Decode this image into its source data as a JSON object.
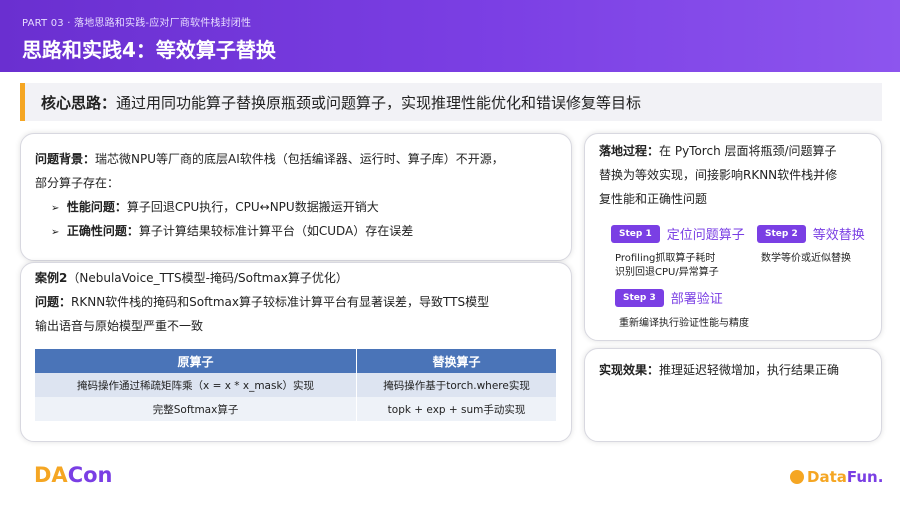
{
  "header": {
    "part_label": "PART 03 · 落地思路和实践-应对厂商软件栈封闭性",
    "title": "思路和实践4：等效算子替换"
  },
  "core": {
    "label": "核心思路：",
    "text": "通过用同功能算子替换原瓶颈或问题算子，实现推理性能优化和错误修复等目标"
  },
  "background": {
    "label": "问题背景：",
    "text1": "瑞芯微NPU等厂商的底层AI软件栈（包括编译器、运行时、算子库）不开源，",
    "text2": "部分算子存在：",
    "bullets": [
      {
        "label": "性能问题：",
        "text": "算子回退CPU执行，CPU↔NPU数据搬运开销大"
      },
      {
        "label": "正确性问题：",
        "text": "算子计算结果较标准计算平台（如CUDA）存在误差"
      }
    ]
  },
  "case": {
    "label": "案例2",
    "title_rest": "（NebulaVoice_TTS模型-掩码/Softmax算子优化）",
    "problem_label": "问题：",
    "problem_text1": "RKNN软件栈的掩码和Softmax算子较标准计算平台有显著误差，导致TTS模型",
    "problem_text2": "输出语音与原始模型严重不一致",
    "table": {
      "headers": [
        "原算子",
        "替换算子"
      ],
      "rows": [
        [
          "掩码操作通过稀疏矩阵乘（x = x * x_mask）实现",
          "掩码操作基于torch.where实现"
        ],
        [
          "完整Softmax算子",
          "topk + exp + sum手动实现"
        ]
      ]
    }
  },
  "process": {
    "label": "落地过程：",
    "text1": "在 PyTorch 层面将瓶颈/问题算子",
    "text2": "替换为等效实现，间接影响RKNN软件栈并修",
    "text3": "复性能和正确性问题",
    "steps": [
      {
        "badge": "Step 1",
        "title": "定位问题算子",
        "desc1": "Profiling抓取算子耗时",
        "desc2": "识别回退CPU/异常算子"
      },
      {
        "badge": "Step 2",
        "title": "等效替换",
        "desc1": "数学等价或近似替换"
      },
      {
        "badge": "Step 3",
        "title": "部署验证",
        "desc1": "重新编译执行验证性能与精度"
      }
    ]
  },
  "effect": {
    "label": "实现效果：",
    "text": "推理延迟轻微增加，执行结果正确"
  },
  "footer": {
    "left_logo_a": "DA",
    "left_logo_b": "Con",
    "right_logo_a": "Data",
    "right_logo_b": "Fun."
  },
  "colors": {
    "header": "#6a2fd0",
    "accent_purple": "#7a3fe4",
    "accent_orange": "#f5a623",
    "table_header": "#4a74b8"
  }
}
